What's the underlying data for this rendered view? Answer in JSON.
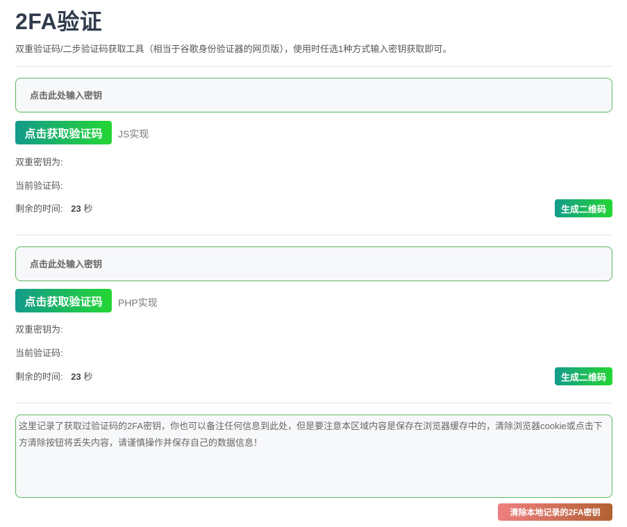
{
  "page": {
    "title": "2FA验证",
    "subtitle": "双重验证码/二步验证码获取工具（相当于谷歌身份验证器的网页版），使用时任选1种方式输入密钥获取即可。"
  },
  "sections": [
    {
      "placeholder": "点击此处输入密钥",
      "get_button": "点击获取验证码",
      "impl_label": "JS实现",
      "secret_label": "双重密钥为:",
      "code_label": "当前验证码:",
      "time_label": "剩余的时间:",
      "time_value": "23",
      "time_unit": "秒",
      "qr_button": "生成二维码"
    },
    {
      "placeholder": "点击此处输入密钥",
      "get_button": "点击获取验证码",
      "impl_label": "PHP实现",
      "secret_label": "双重密钥为:",
      "code_label": "当前验证码:",
      "time_label": "剩余的时间:",
      "time_value": "23",
      "time_unit": "秒",
      "qr_button": "生成二维码"
    }
  ],
  "notes": {
    "text": "这里记录了获取过验证码的2FA密钥，你也可以备注任何信息到此处，但是要注意本区域内容是保存在浏览器缓存中的，清除浏览器cookie或点击下方清除按钮将丢失内容，请谨慎操作并保存自己的数据信息！",
    "clear_button": "清除本地记录的2FA密钥"
  },
  "colors": {
    "accent_start": "#139b8a",
    "accent_end": "#24d634",
    "danger_start": "#ef7f7f",
    "danger_end": "#b26134",
    "border": "#5cb85c"
  }
}
